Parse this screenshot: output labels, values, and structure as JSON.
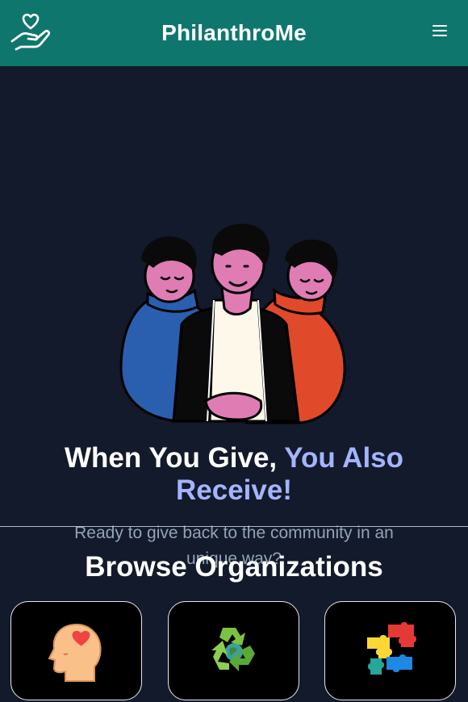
{
  "header": {
    "brand": "PhilanthroMe",
    "logo_icon": "hand-heart-icon",
    "menu_icon": "hamburger-menu-icon"
  },
  "hero": {
    "headline_part1": "When You Give, ",
    "headline_part2": "You Also",
    "headline_part3": "Receive!",
    "subtext": "Ready to give back to the community in an unique way?"
  },
  "browse": {
    "title": "Browse Organizations",
    "cards": [
      {
        "icon": "mental-health-head-heart-icon"
      },
      {
        "icon": "recycle-globe-icon"
      },
      {
        "icon": "puzzle-pieces-icon"
      }
    ]
  },
  "colors": {
    "header_bg": "#0f766e",
    "page_bg": "#121a2b",
    "accent": "#a5b4fc",
    "muted_text": "#94a3b8"
  }
}
